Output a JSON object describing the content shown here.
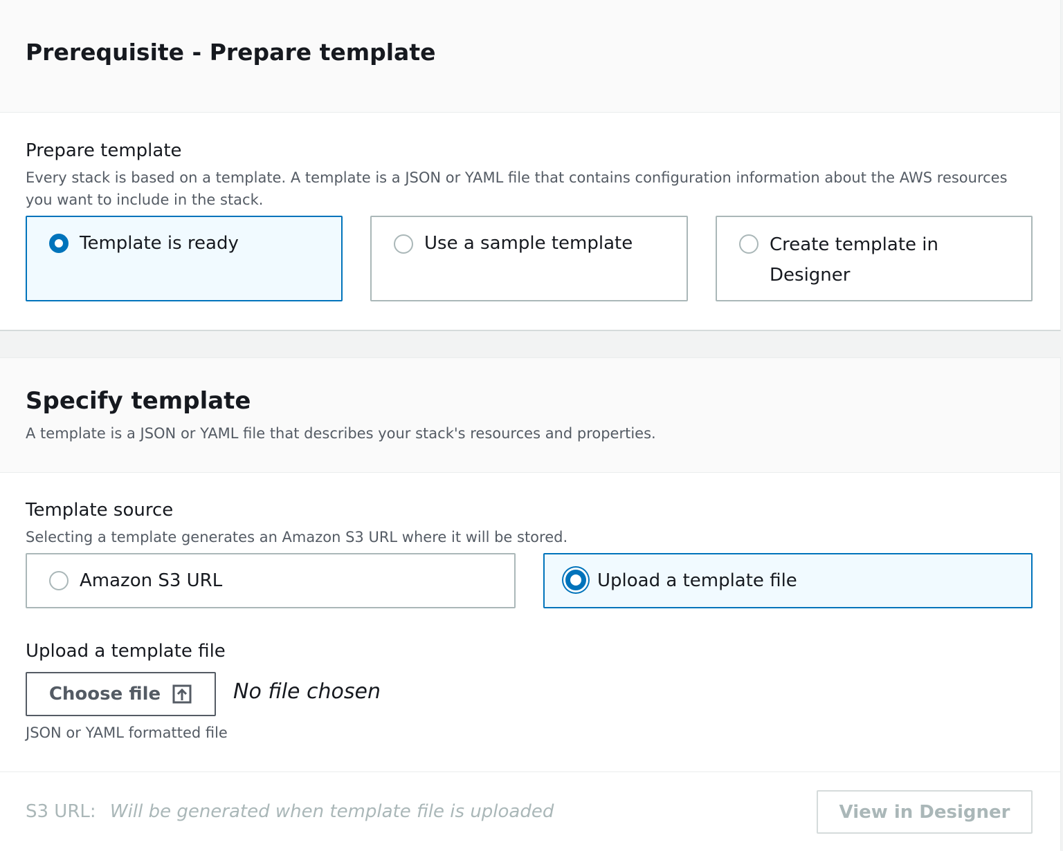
{
  "prereq": {
    "title": "Prerequisite - Prepare template",
    "field_label": "Prepare template",
    "field_description": "Every stack is based on a template. A template is a JSON or YAML file that contains configuration information about the AWS resources you want to include in the stack.",
    "options": [
      {
        "label": "Template is ready",
        "selected": true
      },
      {
        "label": "Use a sample template",
        "selected": false
      },
      {
        "label": "Create template in Designer",
        "selected": false
      }
    ]
  },
  "specify": {
    "title": "Specify template",
    "description": "A template is a JSON or YAML file that describes your stack's resources and properties.",
    "source_label": "Template source",
    "source_description": "Selecting a template generates an Amazon S3 URL where it will be stored.",
    "source_options": [
      {
        "label": "Amazon S3 URL",
        "selected": false
      },
      {
        "label": "Upload a template file",
        "selected": true
      }
    ],
    "upload_label": "Upload a template file",
    "choose_file_label": "Choose file",
    "no_file_text": "No file chosen",
    "upload_hint": "JSON or YAML formatted file",
    "s3_url_label": "S3 URL:",
    "s3_url_value": "Will be generated when template file is uploaded",
    "view_designer_label": "View in Designer"
  },
  "colors": {
    "accent": "#0073bb",
    "selected_bg": "#f1faff",
    "border": "#aab7b8",
    "muted_text": "#545b64",
    "disabled_text": "#aab7b8"
  }
}
